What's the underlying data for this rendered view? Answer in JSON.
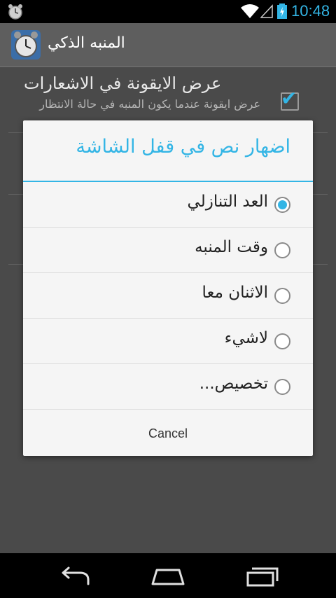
{
  "status_bar": {
    "time": "10:48"
  },
  "action_bar": {
    "title": "المنبه الذكي",
    "icon": "alarm-clock-icon"
  },
  "preference": {
    "title": "عرض الايقونة في الاشعارات",
    "summary": "عرض ايقونة عندما يكون المنبه في حالة الانتظار",
    "checked": true
  },
  "dialog": {
    "title": "اضهار نص في قفل الشاشة",
    "options": [
      {
        "label": "العد التنازلي",
        "selected": true
      },
      {
        "label": "وقت المنبه",
        "selected": false
      },
      {
        "label": "الاثنان معا",
        "selected": false
      },
      {
        "label": "لاشيء",
        "selected": false
      },
      {
        "label": "تخصيص...",
        "selected": false
      }
    ],
    "cancel": "Cancel"
  },
  "colors": {
    "accent": "#33b5e5",
    "dialog_bg": "#f5f5f5",
    "dim_bg": "#4a4a4a"
  }
}
